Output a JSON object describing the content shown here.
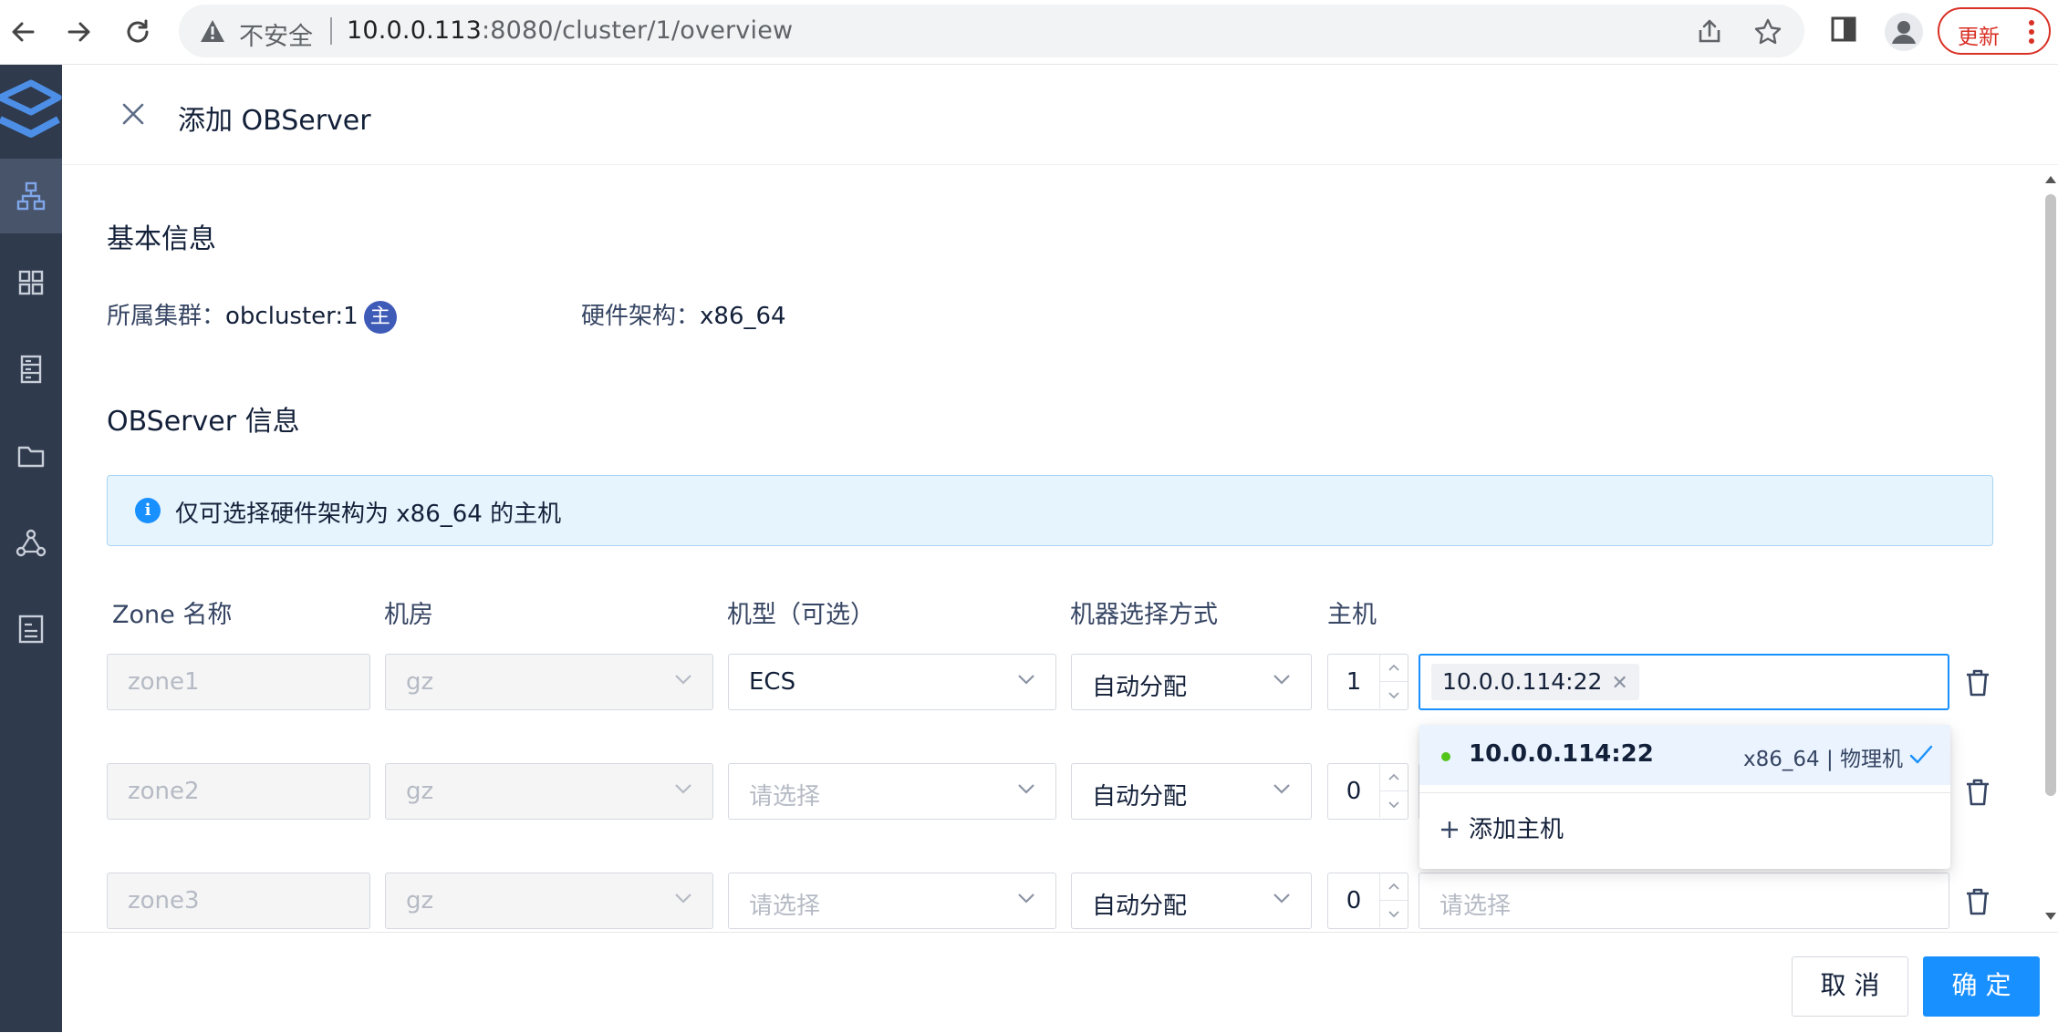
{
  "browser": {
    "security_label": "不安全",
    "url_host": "10.0.0.113",
    "url_rest": ":8080/cluster/1/overview",
    "update_label": "更新"
  },
  "sidebar": {
    "items": [
      {
        "icon": "cluster-topology-icon",
        "active": true
      },
      {
        "icon": "grid-icon",
        "active": false
      },
      {
        "icon": "server-list-icon",
        "active": false
      },
      {
        "icon": "folder-icon",
        "active": false
      },
      {
        "icon": "network-nodes-icon",
        "active": false
      },
      {
        "icon": "monitor-icon",
        "active": false
      }
    ]
  },
  "drawer": {
    "title": "添加 OBServer"
  },
  "basic_info": {
    "title": "基本信息",
    "cluster_label": "所属集群：",
    "cluster_value": "obcluster:1",
    "cluster_badge": "主",
    "arch_label": "硬件架构：",
    "arch_value": "x86_64"
  },
  "observer_info": {
    "title": "OBServer 信息",
    "alert_text": "仅可选择硬件架构为 x86_64 的主机",
    "columns": {
      "zone": "Zone 名称",
      "idc": "机房",
      "model": "机型（可选）",
      "select_mode": "机器选择方式",
      "host": "主机"
    },
    "rows": [
      {
        "zone": "zone1",
        "idc": "gz",
        "model": "ECS",
        "mode": "自动分配",
        "count": "1",
        "host_tag": "10.0.0.114:22",
        "host_placeholder": ""
      },
      {
        "zone": "zone2",
        "idc": "gz",
        "model_placeholder": "请选择",
        "mode": "自动分配",
        "count": "0",
        "host_placeholder": ""
      },
      {
        "zone": "zone3",
        "idc": "gz",
        "model_placeholder": "请选择",
        "mode": "自动分配",
        "count": "0",
        "host_placeholder": "请选择"
      }
    ],
    "dropdown": {
      "option_host": "10.0.0.114:22",
      "option_meta": "x86_64 | 物理机",
      "add_host": "添加主机"
    }
  },
  "footer": {
    "cancel": "取 消",
    "confirm": "确 定"
  },
  "colors": {
    "primary": "#1890ff",
    "sidebar_bg": "#2f3a4d",
    "alert_bg": "#e6f4fd",
    "update_red": "#d93025"
  }
}
